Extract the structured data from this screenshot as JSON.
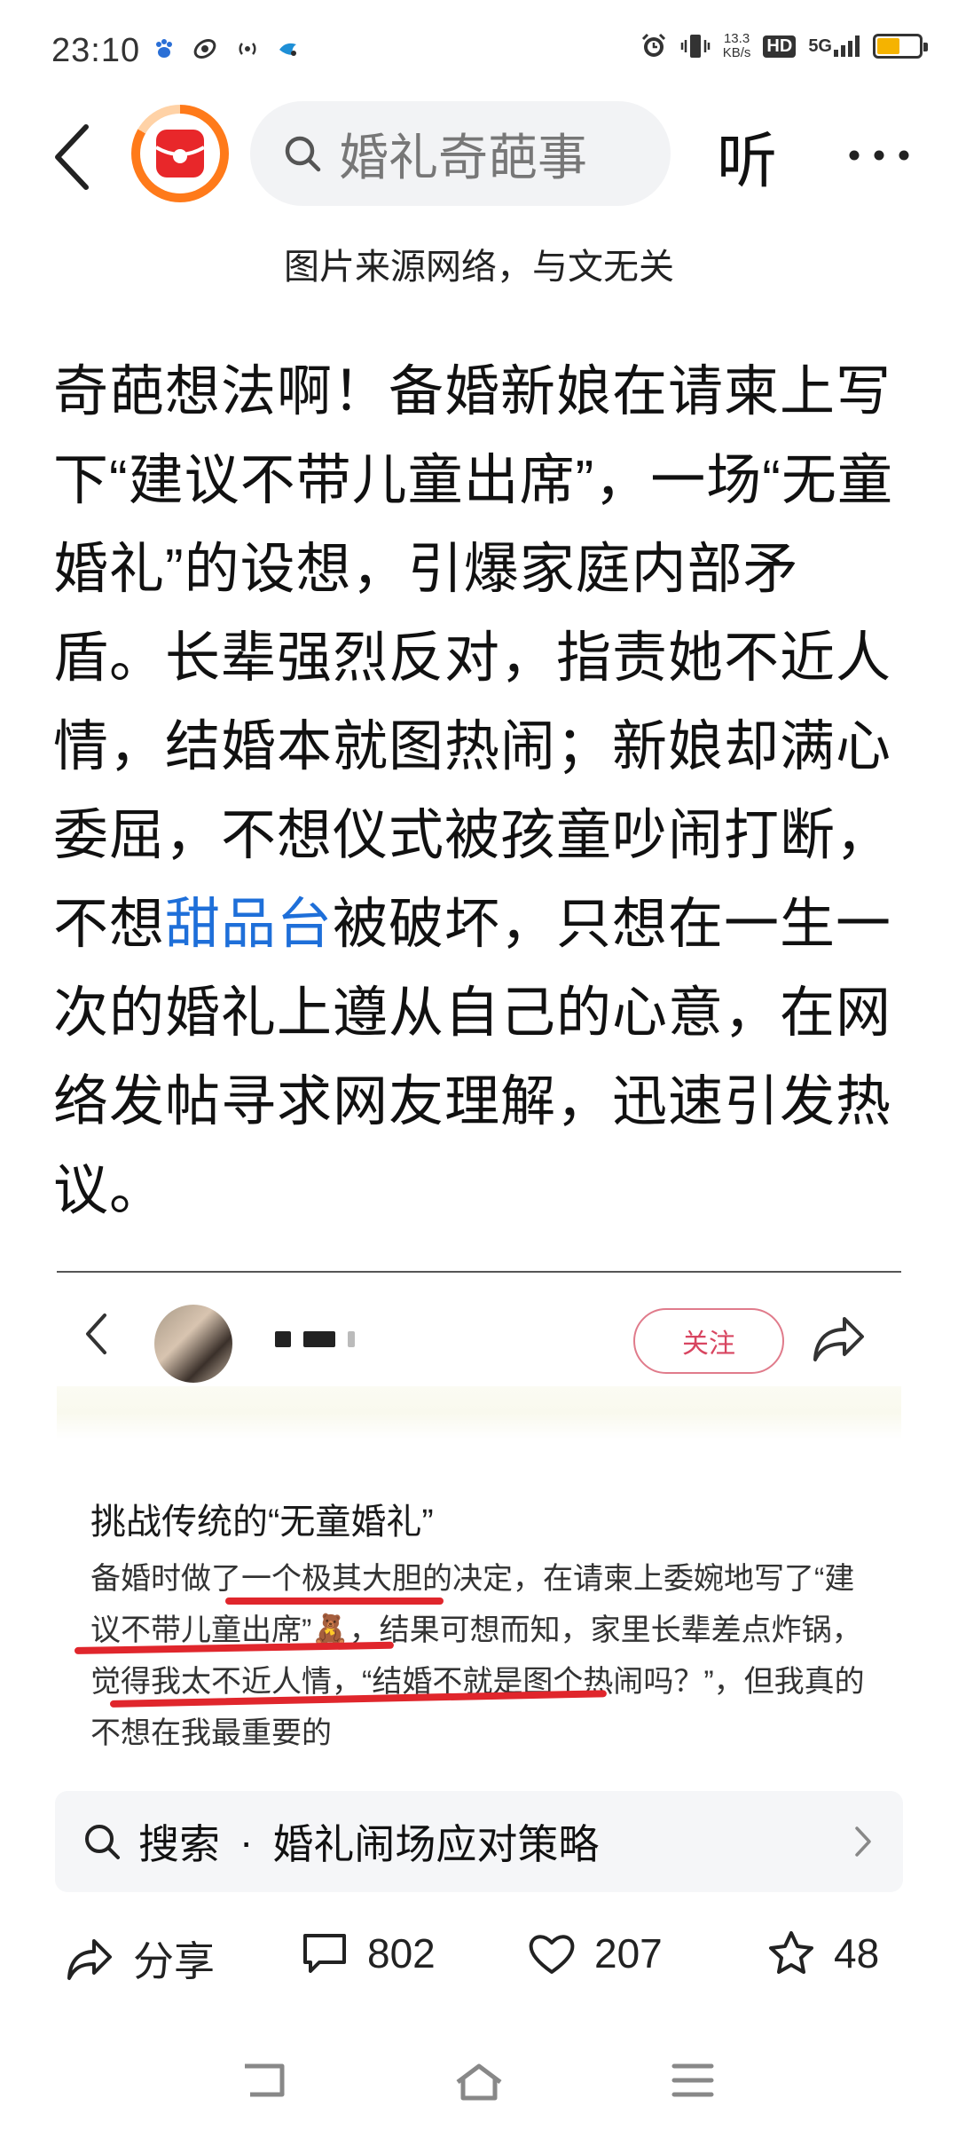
{
  "status_bar": {
    "time": "23:10",
    "net_speed_value": "13.3",
    "net_speed_unit": "KB/s",
    "hd_label": "HD",
    "network": "5G",
    "battery_level": 0.55
  },
  "nav": {
    "search_text": "婚礼奇葩事",
    "listen_label": "听"
  },
  "image_caption": "图片来源网络，与文无关",
  "article": {
    "before_link": "奇葩想法啊！备婚新娘在请柬上写下“建议不带儿童出席”，一场“无童婚礼”的设想，引爆家庭内部矛盾。长辈强烈反对，指责她不近人情，结婚本就图热闹；新娘却满心委屈，不想仪式被孩童吵闹打断，不想",
    "link_text": "甜品台",
    "after_link": "被破坏，只想在一生一次的婚礼上遵从自己的心意，在网络发帖寻求网友理解，迅速引发热议。"
  },
  "embedded_post": {
    "follow_label": "关注",
    "title": "挑战传统的“无童婚礼”",
    "body": "备婚时做了一个极其大胆的决定，在请柬上委婉地写了“建议不带儿童出席”🧸，结果可想而知，家里长辈差点炸锅，觉得我太不近人情，“结婚不就是图个热闹吗？”，但我真的不想在我最重要的"
  },
  "search_suggestion": {
    "label": "搜索",
    "separator": "·",
    "term": "婚礼闹场应对策略"
  },
  "actions": {
    "share_label": "分享",
    "comment_count": "802",
    "like_count": "207",
    "favorite_count": "48"
  },
  "colors": {
    "link": "#1e6fd9",
    "follow": "#d84560",
    "underline": "#e0262c",
    "accent_logo": "#ff7a1a"
  }
}
